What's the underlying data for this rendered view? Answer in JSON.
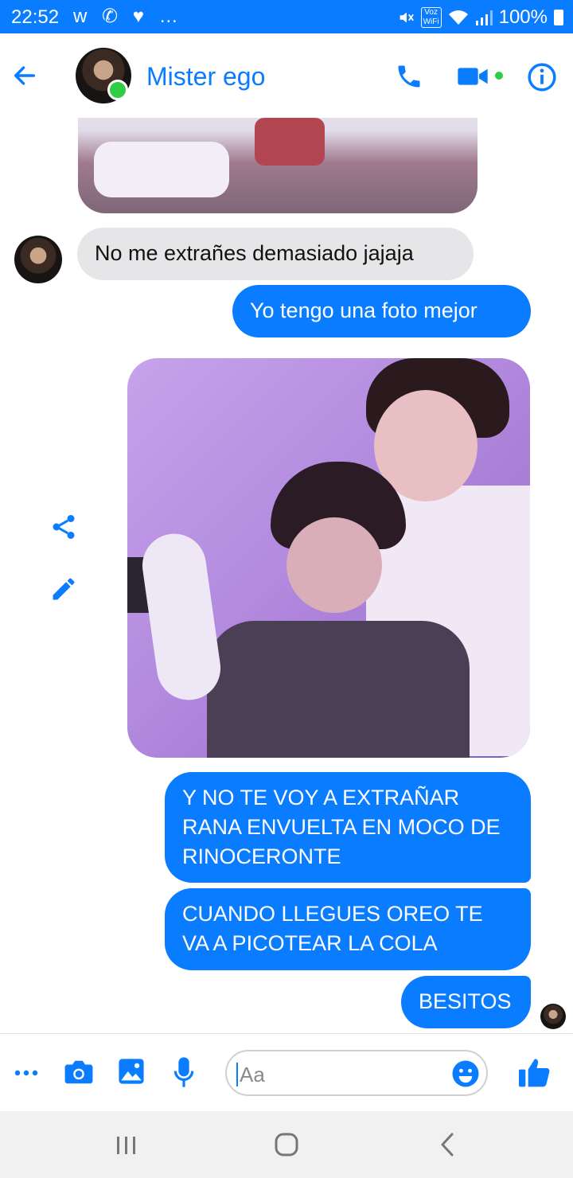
{
  "status_bar": {
    "time": "22:52",
    "app_icons": "w ✆ ♥ …",
    "wifi_badge_top": "Voz",
    "wifi_badge_bottom": "WiFi",
    "battery": "100%"
  },
  "header": {
    "contact_name": "Mister ego",
    "contact_online": true
  },
  "messages": [
    {
      "type": "image",
      "sender": "contact"
    },
    {
      "type": "text",
      "sender": "contact",
      "text": "No me extrañes demasiado jajaja"
    },
    {
      "type": "text",
      "sender": "me",
      "text": "Yo tengo una foto mejor"
    },
    {
      "type": "image",
      "sender": "me"
    },
    {
      "type": "text",
      "sender": "me",
      "text": "Y NO TE VOY A EXTRAÑAR RANA ENVUELTA EN MOCO DE RINOCERONTE"
    },
    {
      "type": "text",
      "sender": "me",
      "text": "CUANDO LLEGUES OREO TE VA A PICOTEAR LA COLA"
    },
    {
      "type": "text",
      "sender": "me",
      "text": "BESITOS"
    }
  ],
  "composer": {
    "placeholder": "Aa",
    "value": ""
  },
  "colors": {
    "accent": "#0a7cff",
    "incoming_bubble": "#e6e6e8",
    "online": "#31cc46"
  },
  "icons": {
    "header": [
      "back-arrow-icon",
      "phone-icon",
      "video-camera-icon",
      "info-icon"
    ],
    "photo_actions": [
      "share-icon",
      "edit-pencil-icon"
    ],
    "composer": [
      "more-dots-icon",
      "camera-icon",
      "gallery-icon",
      "microphone-icon",
      "emoji-icon",
      "thumbs-up-icon"
    ],
    "system_nav": [
      "recents-icon",
      "home-icon",
      "back-icon"
    ]
  }
}
